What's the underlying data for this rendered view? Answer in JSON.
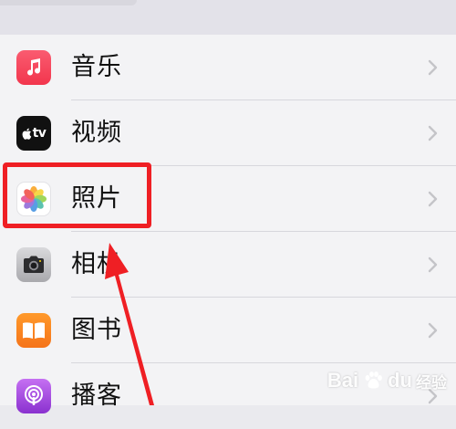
{
  "settings_list": {
    "items": [
      {
        "label": "音乐",
        "icon": "music-icon"
      },
      {
        "label": "视频",
        "icon": "apple-tv-icon",
        "icon_text": "tv"
      },
      {
        "label": "照片",
        "icon": "photos-icon"
      },
      {
        "label": "相机",
        "icon": "camera-icon"
      },
      {
        "label": "图书",
        "icon": "books-icon"
      },
      {
        "label": "播客",
        "icon": "podcasts-icon"
      }
    ],
    "chevron": "chevron-right-icon"
  },
  "annotation": {
    "highlight_color": "#ef1f24",
    "arrow_color": "#ef1f24"
  },
  "watermark": {
    "brand": "Bai",
    "brand_suffix": "du",
    "sub": "经验"
  }
}
